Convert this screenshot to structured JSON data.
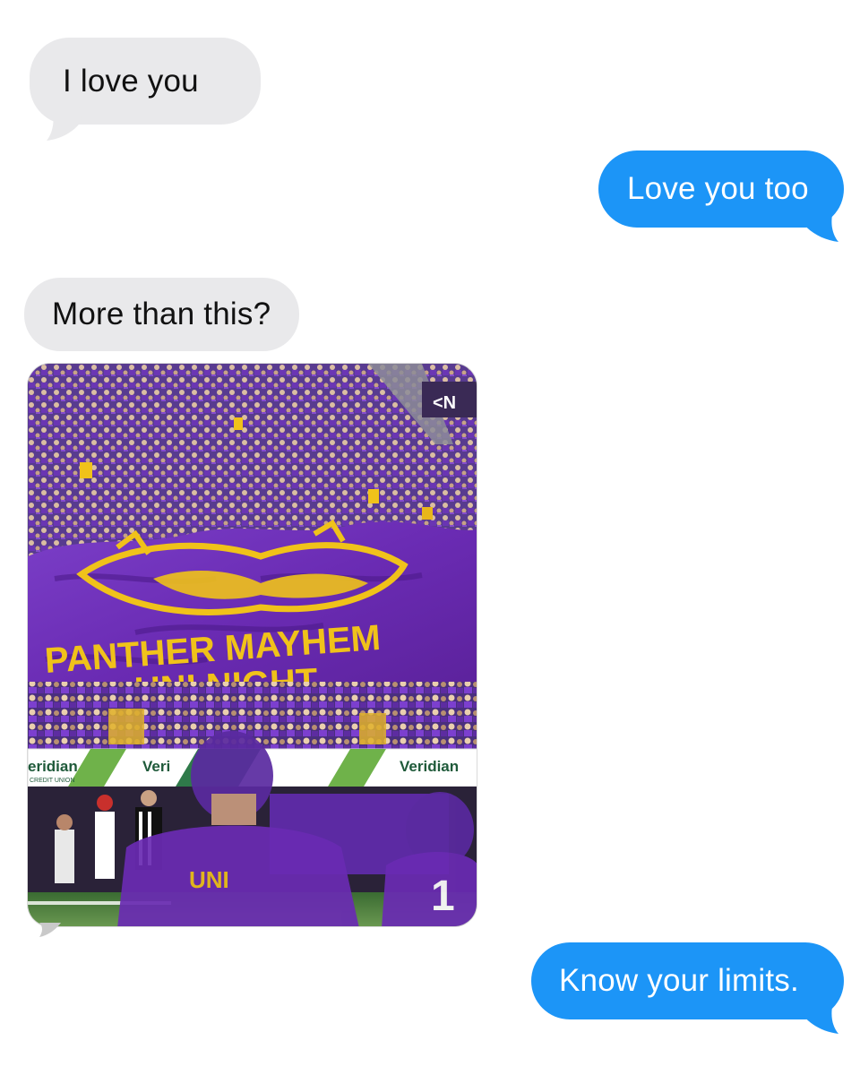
{
  "conversation": {
    "messages": [
      {
        "direction": "received",
        "text": "I love you"
      },
      {
        "direction": "sent",
        "text": "Love you too"
      },
      {
        "direction": "received",
        "text": "More than this?"
      },
      {
        "direction": "received",
        "type": "photo",
        "photo": {
          "banner_text_line1": "PANTHER MAYHEM",
          "banner_text_line2": "UNI NIGHT",
          "sponsor_board": [
            "eridian",
            "Veri",
            "Veridian",
            "Veridian"
          ],
          "sponsor_subtext": "CREDIT UNION",
          "jersey_text": "UNI",
          "jersey_number": "1"
        }
      },
      {
        "direction": "sent",
        "text": "Know your limits."
      }
    ]
  },
  "colors": {
    "sent_bubble": "#1c95f7",
    "received_bubble": "#e9e9eb",
    "purple": "#6a2bb3",
    "gold": "#f0c21a"
  }
}
